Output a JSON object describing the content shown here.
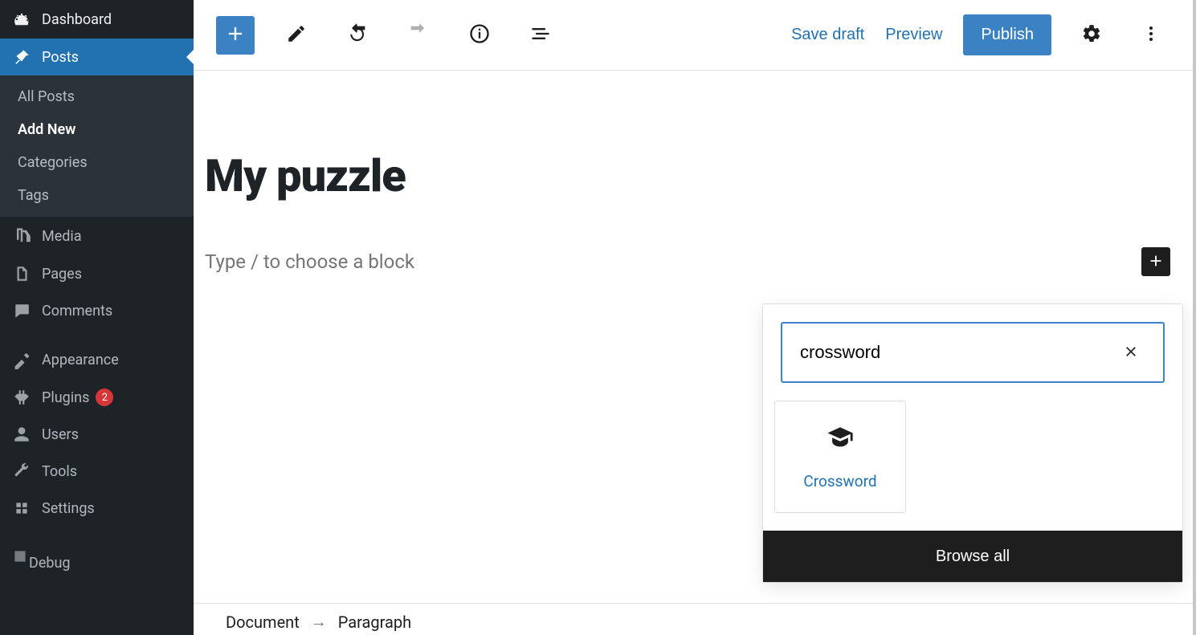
{
  "sidebar": {
    "dashboard": "Dashboard",
    "posts": "Posts",
    "posts_submenu": {
      "all": "All Posts",
      "add_new": "Add New",
      "categories": "Categories",
      "tags": "Tags"
    },
    "media": "Media",
    "pages": "Pages",
    "comments": "Comments",
    "appearance": "Appearance",
    "plugins": "Plugins",
    "plugins_badge": "2",
    "users": "Users",
    "tools": "Tools",
    "settings": "Settings",
    "debug": "Debug"
  },
  "toolbar": {
    "save_draft": "Save draft",
    "preview": "Preview",
    "publish": "Publish"
  },
  "editor": {
    "title": "My puzzle",
    "placeholder": "Type / to choose a block"
  },
  "inserter": {
    "search_value": "crossword",
    "result_label": "Crossword",
    "browse_all": "Browse all"
  },
  "breadcrumb": {
    "root": "Document",
    "current": "Paragraph"
  }
}
